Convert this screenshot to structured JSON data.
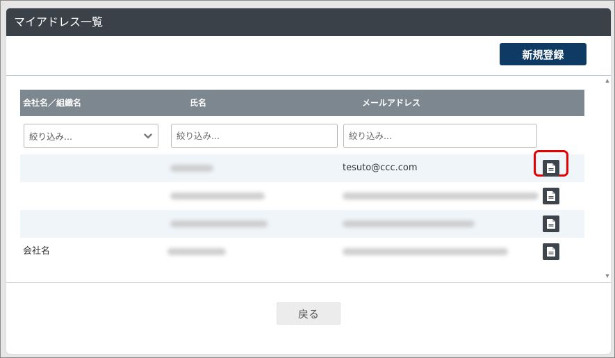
{
  "dialog": {
    "title": "マイアドレス一覧",
    "new_button_label": "新規登録",
    "back_button_label": "戻る"
  },
  "table": {
    "columns": [
      "会社名／組織名",
      "氏名",
      "メールアドレス"
    ],
    "filters": {
      "company_placeholder": "絞り込み...",
      "name_placeholder": "絞り込み...",
      "email_placeholder": "絞り込み..."
    },
    "rows": [
      {
        "company": "",
        "name": "(blurred)",
        "email": "tesuto@ccc.com",
        "highlighted": true
      },
      {
        "company": "",
        "name": "(blurred)",
        "email": "(blurred)",
        "highlighted": false
      },
      {
        "company": "",
        "name": "(blurred)",
        "email": "(blurred)",
        "highlighted": false
      },
      {
        "company": "会社名",
        "name": "(blurred)",
        "email": "(blurred)",
        "highlighted": false
      }
    ]
  },
  "icons": {
    "detail": "document-icon",
    "filter_dropdown": "chevron-down-icon",
    "scroll_up": "triangle-up-icon",
    "scroll_down": "triangle-down-icon"
  },
  "colors": {
    "titlebar": "#3b4148",
    "primary_button": "#0e3a63",
    "table_header": "#7d878f",
    "row_alt": "#f0f5f9",
    "highlight": "#e60000"
  }
}
